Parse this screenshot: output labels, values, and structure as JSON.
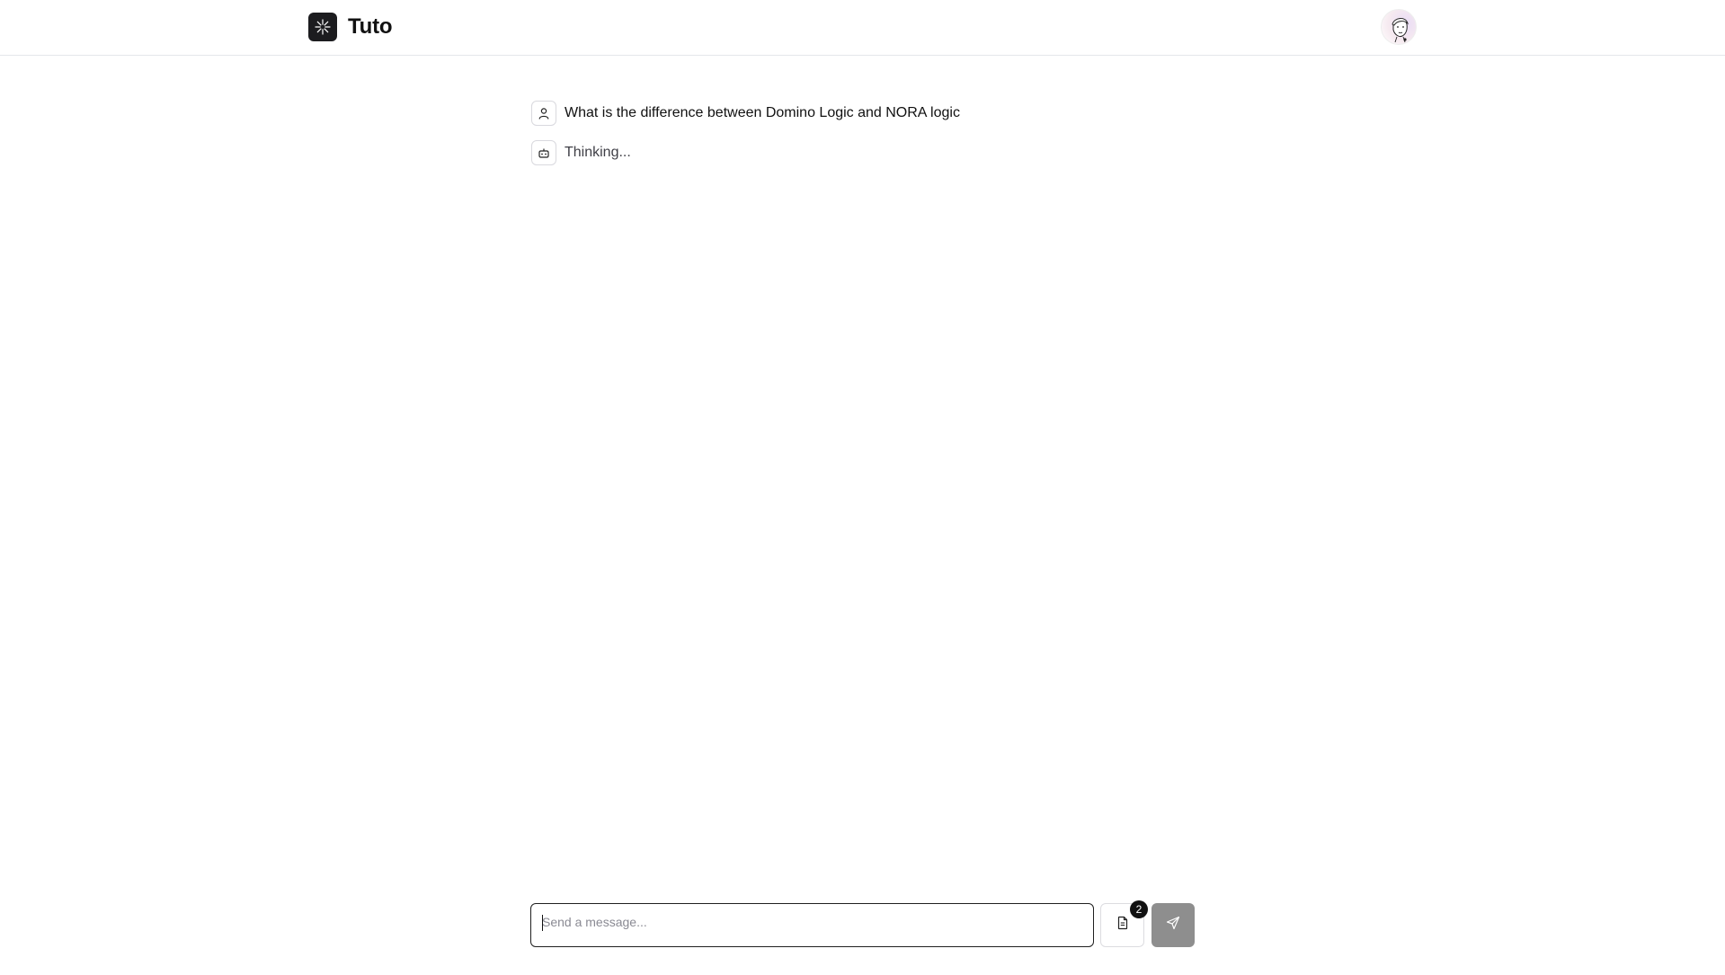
{
  "app": {
    "title": "Tuto",
    "logo_icon": "asterisk-logo-icon",
    "avatar_icon": "user-avatar"
  },
  "messages": [
    {
      "role": "user",
      "icon": "user-icon",
      "text": "What is the difference between Domino Logic and NORA logic"
    },
    {
      "role": "assistant",
      "icon": "bot-icon",
      "text": "Thinking..."
    }
  ],
  "composer": {
    "placeholder": "Send a message...",
    "value": "",
    "attachments_icon": "document-icon",
    "attachments_count": "2",
    "send_icon": "send-icon"
  },
  "colors": {
    "logo_bg": "#1c1c1f",
    "send_button_disabled": "#8e8e8e",
    "badge_bg": "#111111"
  }
}
